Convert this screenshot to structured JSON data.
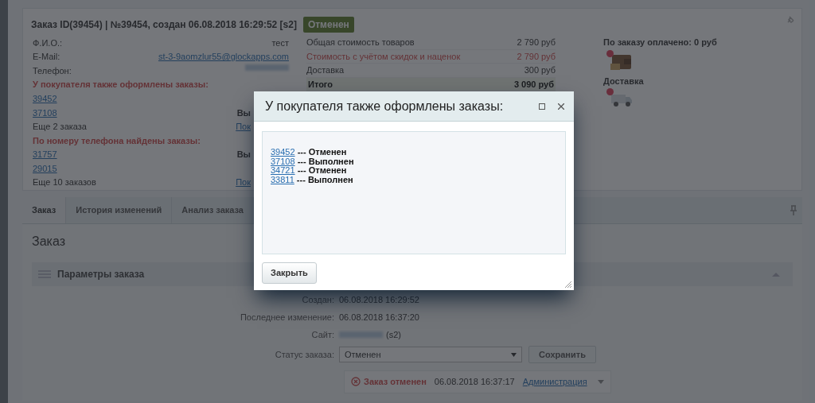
{
  "order": {
    "title": "Заказ ID(39454) | №39454, создан 06.08.2018 16:29:52 [s2]",
    "status_badge": "Отменен",
    "customer": [
      {
        "kind": "field",
        "label": "Ф.И.О.:",
        "value": "тест"
      },
      {
        "kind": "email",
        "label": "E-Mail:",
        "value": "st-3-9aomzlur55@glockapps.com"
      },
      {
        "kind": "hidden",
        "label": "Телефон:"
      },
      {
        "kind": "heading",
        "label": "У покупателя также оформлены заказы:"
      },
      {
        "kind": "link",
        "label": "39452"
      },
      {
        "kind": "link",
        "label": "37108",
        "aside": "Вы"
      },
      {
        "kind": "more",
        "label": "Еще 2 заказа",
        "aside": "Пок"
      },
      {
        "kind": "heading",
        "label": "По номеру телефона найдены заказы:"
      },
      {
        "kind": "link",
        "label": "31757",
        "aside": "Вы"
      },
      {
        "kind": "link",
        "label": "29015"
      },
      {
        "kind": "more",
        "label": "Еще 10 заказов",
        "aside": "Пок"
      }
    ],
    "totals": [
      {
        "kind": "normal",
        "label": "Общая стоимость товаров",
        "value": "2 790 руб"
      },
      {
        "kind": "discount",
        "label": "Стоимость с учётом скидок и наценок",
        "value": "2 790 руб"
      },
      {
        "kind": "normal",
        "label": "Доставка",
        "value": "300 руб"
      },
      {
        "kind": "total",
        "label": "Итого",
        "value": "3 090 руб"
      }
    ],
    "payment": {
      "title": "По заказу оплачено: 0 руб"
    },
    "delivery": {
      "title": "Доставка"
    }
  },
  "tabs": [
    {
      "label": "Заказ",
      "selected": true
    },
    {
      "label": "История изменений",
      "selected": false
    },
    {
      "label": "Анализ заказа",
      "selected": false
    }
  ],
  "section_title": "Заказ",
  "panel": {
    "title": "Параметры заказа",
    "params": [
      {
        "kind": "text",
        "label": "Создан:",
        "value": "06.08.2018 16:29:52"
      },
      {
        "kind": "text",
        "label": "Последнее изменение:",
        "value": "06.08.2018 16:37:20"
      },
      {
        "kind": "site",
        "label": "Сайт:",
        "value": "(s2)"
      }
    ],
    "status": {
      "label": "Статус заказа:",
      "value": "Отменен",
      "button": "Сохранить"
    },
    "history": {
      "status": "Заказ отменен",
      "date": "06.08.2018 16:37:17",
      "user": "Администрация"
    }
  },
  "dialog": {
    "title": "У покупателя также оформлены заказы:",
    "orders": [
      {
        "number": "39452",
        "status": "--- Отменен"
      },
      {
        "number": "37108",
        "status": "--- Выполнен"
      },
      {
        "number": "34721",
        "status": "--- Отменен"
      },
      {
        "number": "33811",
        "status": "--- Выполнен"
      }
    ],
    "button": "Закрыть"
  }
}
